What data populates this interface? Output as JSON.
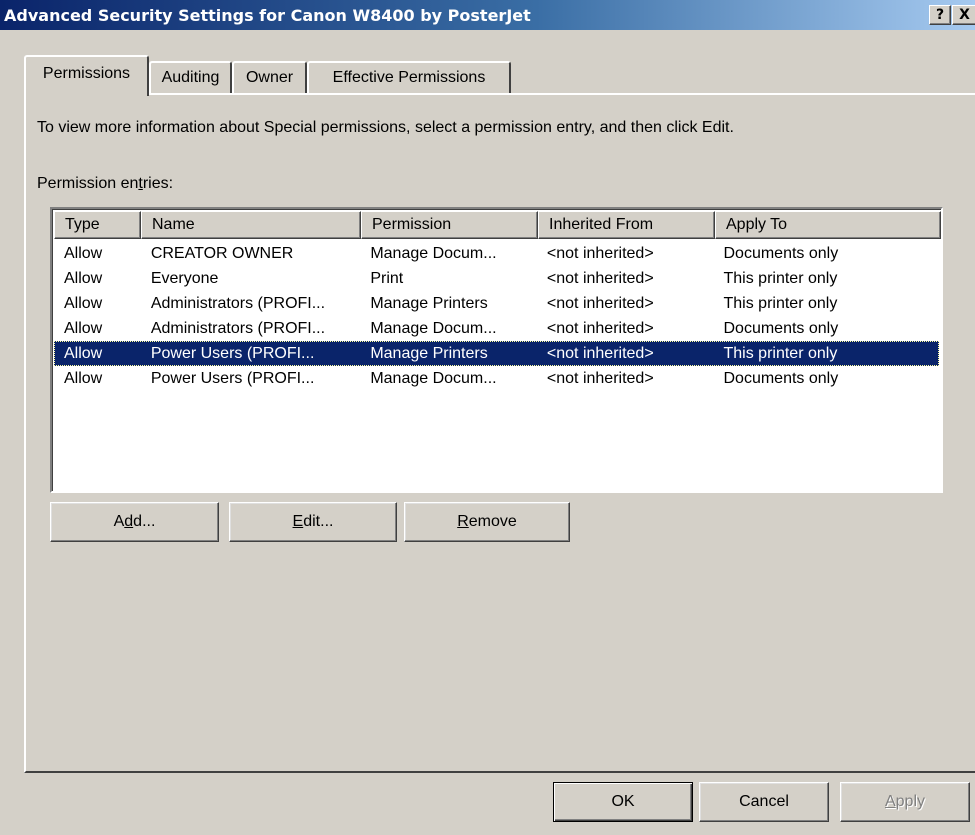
{
  "window": {
    "title": "Advanced Security Settings for Canon W8400 by PosterJet",
    "help_glyph": "?",
    "close_glyph": "X"
  },
  "tabs": [
    {
      "label": "Permissions",
      "active": true
    },
    {
      "label": "Auditing",
      "active": false
    },
    {
      "label": "Owner",
      "active": false
    },
    {
      "label": "Effective Permissions",
      "active": false
    }
  ],
  "permissions_tab": {
    "info_text": "To view more information about Special permissions, select a permission entry, and then click Edit.",
    "entries_label_a": "Permission en",
    "entries_label_mn": "t",
    "entries_label_b": "ries:",
    "columns": [
      "Type",
      "Name",
      "Permission",
      "Inherited From",
      "Apply To"
    ],
    "rows": [
      [
        "Allow",
        "CREATOR OWNER",
        "Manage Docum...",
        "<not inherited>",
        "Documents only"
      ],
      [
        "Allow",
        "Everyone",
        "Print",
        "<not inherited>",
        "This printer only"
      ],
      [
        "Allow",
        "Administrators (PROFI...",
        "Manage Printers",
        "<not inherited>",
        "This printer only"
      ],
      [
        "Allow",
        "Administrators (PROFI...",
        "Manage Docum...",
        "<not inherited>",
        "Documents only"
      ],
      [
        "Allow",
        "Power Users (PROFI...",
        "Manage Printers",
        "<not inherited>",
        "This printer only"
      ],
      [
        "Allow",
        "Power Users (PROFI...",
        "Manage Docum...",
        "<not inherited>",
        "Documents only"
      ]
    ],
    "selected_row": 4,
    "buttons": {
      "add": {
        "a": "A",
        "mn": "d",
        "b": "d..."
      },
      "edit": {
        "a": "",
        "mn": "E",
        "b": "dit..."
      },
      "remove": {
        "a": "",
        "mn": "R",
        "b": "emove"
      }
    }
  },
  "footer": {
    "ok": "OK",
    "cancel": "Cancel",
    "apply_mn": "A",
    "apply_rest": "pply"
  },
  "colors": {
    "face": "#d4d0c8",
    "titlebar_start": "#0a246a",
    "titlebar_end": "#a6caf0",
    "selection": "#0a246a"
  }
}
